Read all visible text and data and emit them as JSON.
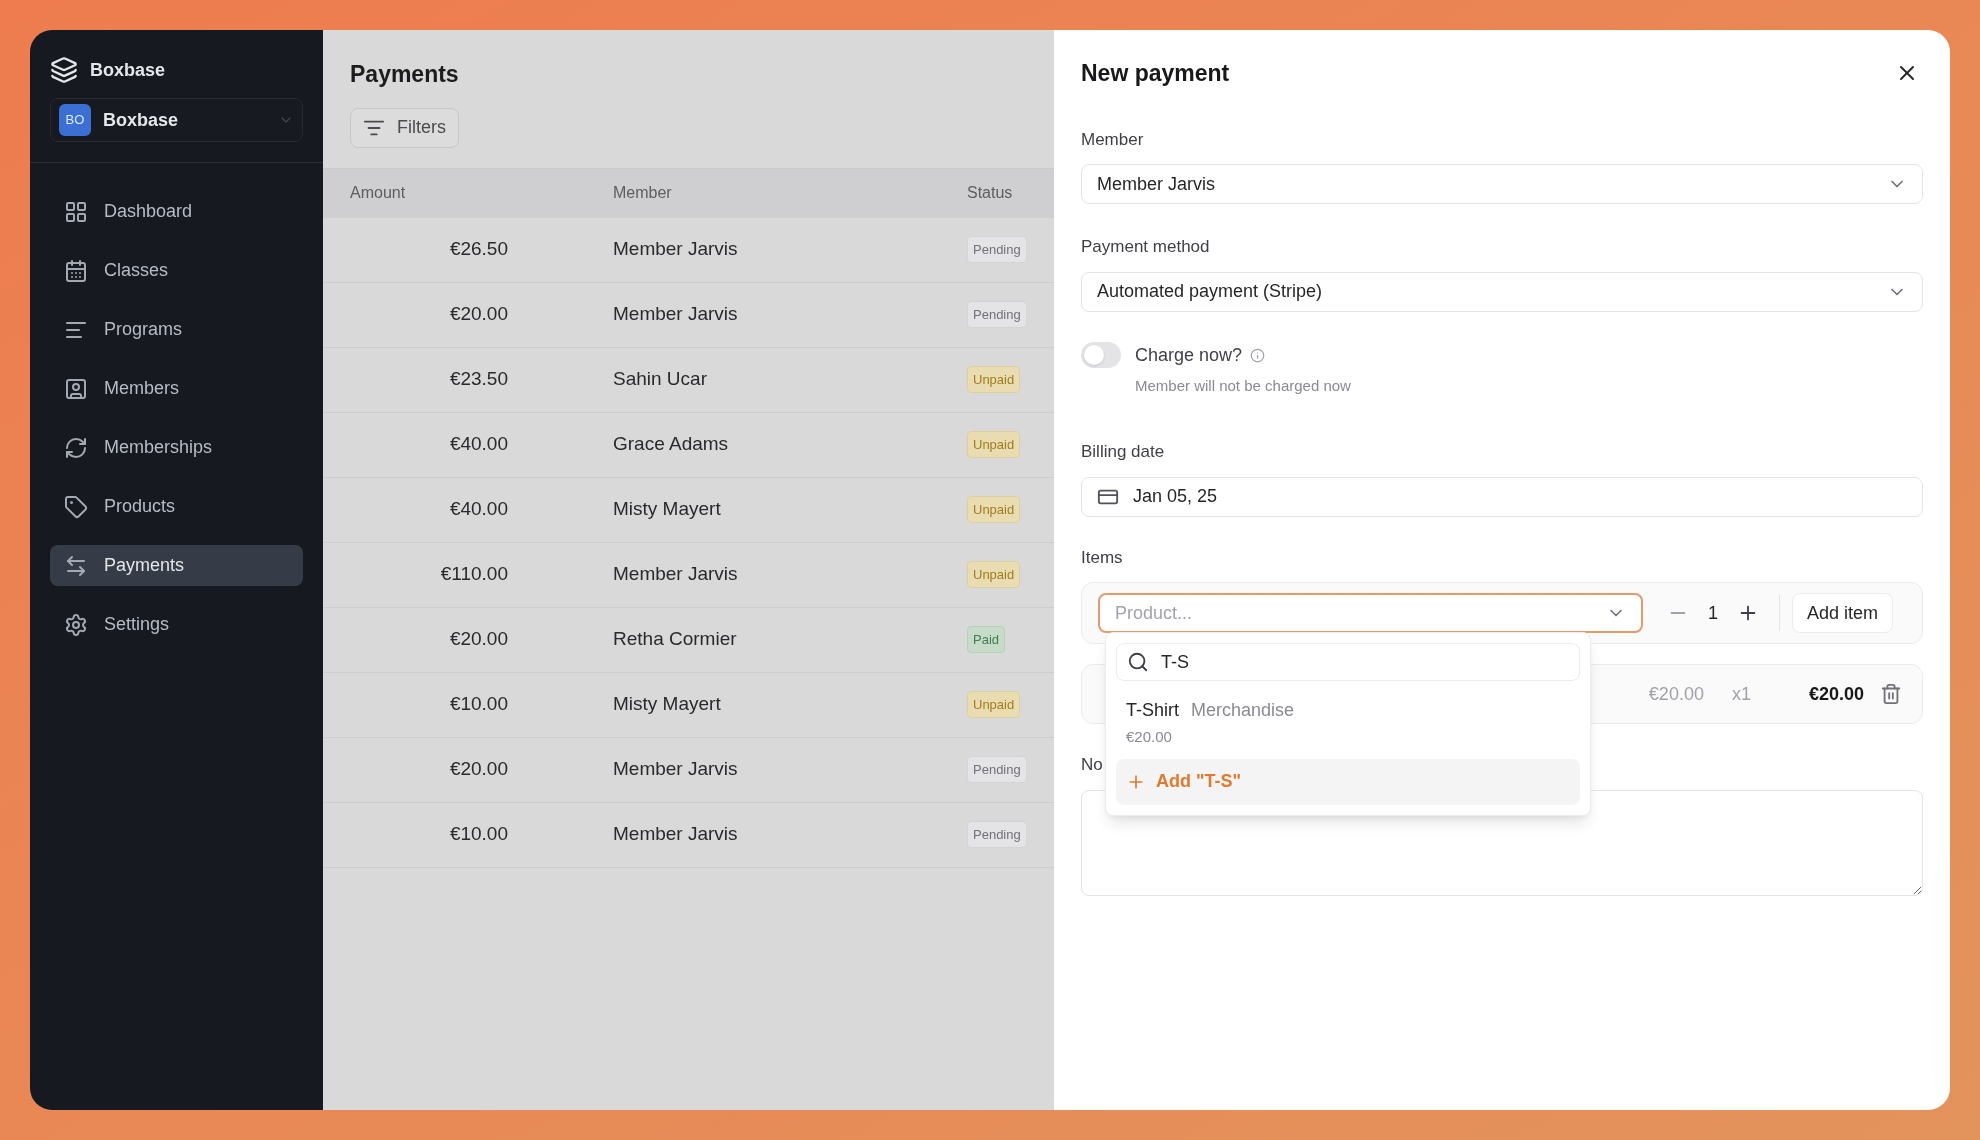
{
  "sidebar": {
    "brand": "Boxbase",
    "workspace": {
      "initials": "BO",
      "name": "Boxbase"
    },
    "items": [
      {
        "label": "Dashboard",
        "selected": false
      },
      {
        "label": "Classes",
        "selected": false
      },
      {
        "label": "Programs",
        "selected": false
      },
      {
        "label": "Members",
        "selected": false
      },
      {
        "label": "Memberships",
        "selected": false
      },
      {
        "label": "Products",
        "selected": false
      },
      {
        "label": "Payments",
        "selected": true
      },
      {
        "label": "Settings",
        "selected": false
      }
    ]
  },
  "page": {
    "title": "Payments",
    "filters_button": "Filters",
    "table": {
      "columns": [
        "Amount",
        "Member",
        "Status"
      ],
      "rows": [
        {
          "amount": "€26.50",
          "member": "Member Jarvis",
          "status": "Pending",
          "kind": "pending"
        },
        {
          "amount": "€20.00",
          "member": "Member Jarvis",
          "status": "Pending",
          "kind": "pending"
        },
        {
          "amount": "€23.50",
          "member": "Sahin Ucar",
          "status": "Unpaid",
          "kind": "unpaid"
        },
        {
          "amount": "€40.00",
          "member": "Grace Adams",
          "status": "Unpaid",
          "kind": "unpaid"
        },
        {
          "amount": "€40.00",
          "member": "Misty Mayert",
          "status": "Unpaid",
          "kind": "unpaid"
        },
        {
          "amount": "€110.00",
          "member": "Member Jarvis",
          "status": "Unpaid",
          "kind": "unpaid"
        },
        {
          "amount": "€20.00",
          "member": "Retha Cormier",
          "status": "Paid",
          "kind": "paid"
        },
        {
          "amount": "€10.00",
          "member": "Misty Mayert",
          "status": "Unpaid",
          "kind": "unpaid"
        },
        {
          "amount": "€20.00",
          "member": "Member Jarvis",
          "status": "Pending",
          "kind": "pending"
        },
        {
          "amount": "€10.00",
          "member": "Member Jarvis",
          "status": "Pending",
          "kind": "pending"
        }
      ]
    }
  },
  "panel": {
    "title": "New payment",
    "member": {
      "label": "Member",
      "value": "Member Jarvis"
    },
    "payment_method": {
      "label": "Payment method",
      "value": "Automated payment (Stripe)"
    },
    "charge_now": {
      "label": "Charge now?",
      "hint": "Member will not be charged now",
      "on": false
    },
    "billing_date": {
      "label": "Billing date",
      "value": "Jan 05, 25"
    },
    "items": {
      "label": "Items",
      "product_placeholder": "Product...",
      "quantity": "1",
      "add_button": "Add item",
      "added": {
        "unit_price": "€20.00",
        "quantity": "x1",
        "total": "€20.00"
      }
    },
    "notes": {
      "label": "No"
    },
    "dropdown": {
      "search": "T-S",
      "options": [
        {
          "name": "T-Shirt",
          "category": "Merchandise",
          "price": "€20.00"
        }
      ],
      "create": "Add \"T-S\""
    }
  }
}
